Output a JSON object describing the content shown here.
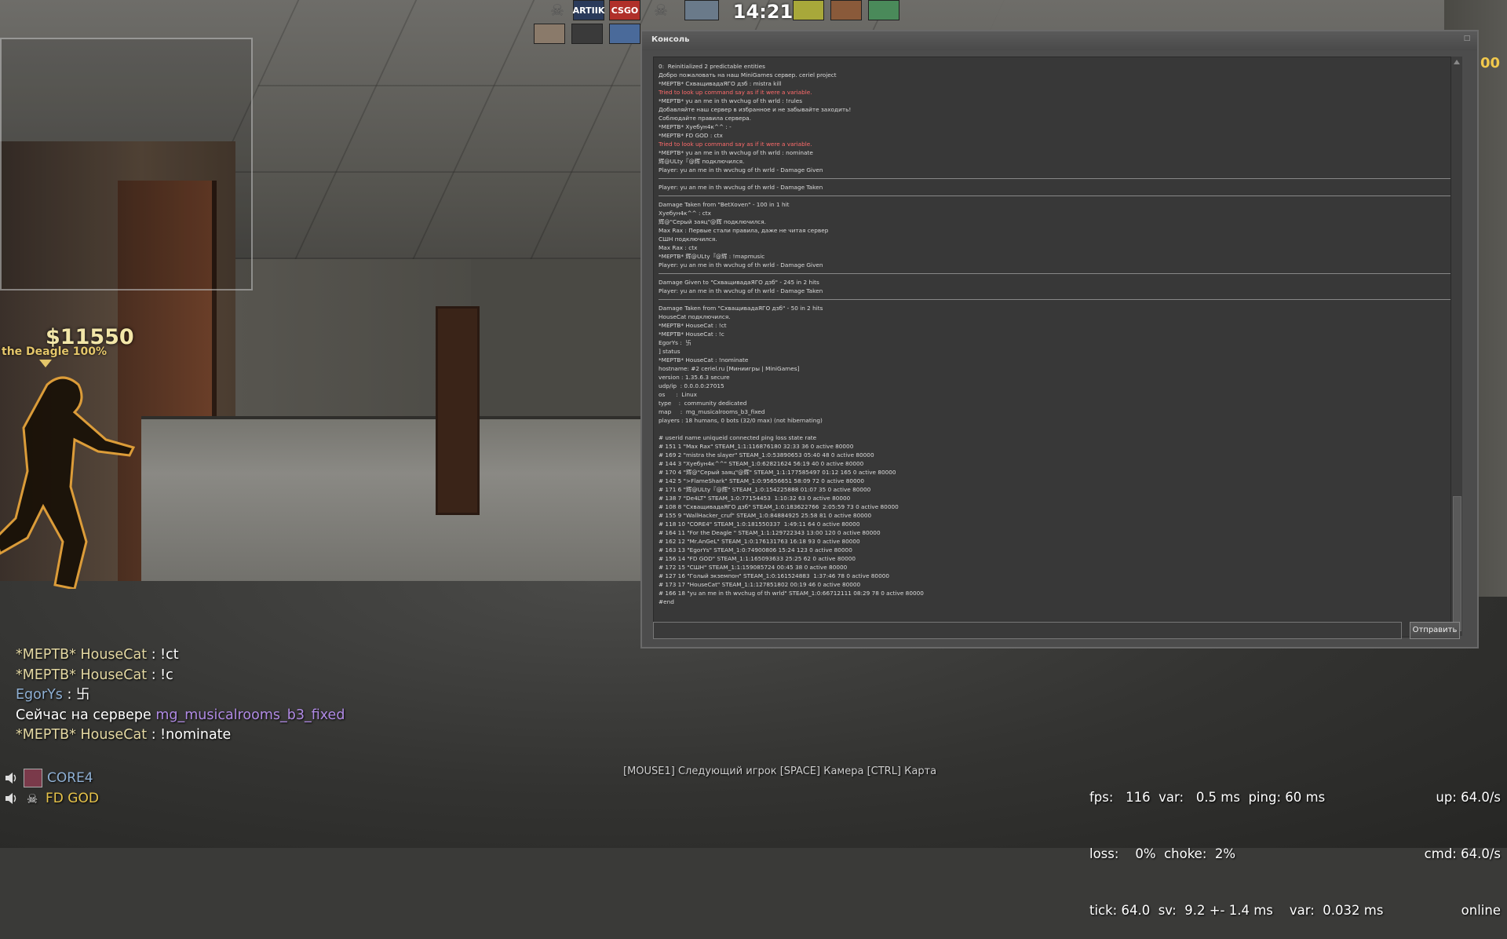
{
  "hud": {
    "money": "$11550",
    "weapon": "the Deagle  100%",
    "time": "14:21",
    "team_badges": [
      "ARTIIK",
      "CSGO"
    ],
    "score_partial": "00"
  },
  "console": {
    "title": "Консоль",
    "send_label": "Отправить",
    "input_value": "",
    "lines": [
      {
        "t": "0:  Reinitialized 2 predictable entities",
        "k": "n"
      },
      {
        "t": "Добро пожаловать на наш MiniGames сервер. ceriel project",
        "k": "n"
      },
      {
        "t": "*МЕРТВ* СхващивадаЯГО дзб : mistra kill",
        "k": "n"
      },
      {
        "t": "Tried to look up command say as if it were a variable.",
        "k": "e"
      },
      {
        "t": "*МЕРТВ* yu an me in th wvchug of th wrld : !rules",
        "k": "n"
      },
      {
        "t": "Добавляйте наш сервер в избранное и не забывайте заходить!",
        "k": "n"
      },
      {
        "t": "Соблюдайте правила сервера.",
        "k": "n"
      },
      {
        "t": "*МЕРТВ* Хуебун4к^^ : -",
        "k": "n"
      },
      {
        "t": "*МЕРТВ* FD GOD : ctx",
        "k": "n"
      },
      {
        "t": "Tried to look up command say as if it were a variable.",
        "k": "e"
      },
      {
        "t": "*МЕРТВ* yu an me in th wvchug of th wrld : nominate",
        "k": "n"
      },
      {
        "t": "辉@ULty『@辉 подключился.",
        "k": "n"
      },
      {
        "t": "Player: yu an me in th wvchug of th wrld - Damage Given",
        "k": "n"
      },
      {
        "t": "",
        "k": "s"
      },
      {
        "t": "Player: yu an me in th wvchug of th wrld - Damage Taken",
        "k": "n"
      },
      {
        "t": "",
        "k": "s"
      },
      {
        "t": "Damage Taken from \"BetXoven\" - 100 in 1 hit",
        "k": "n"
      },
      {
        "t": "Хуебун4к^^ : ctx",
        "k": "n"
      },
      {
        "t": "辉@\"Серый заяц\"@辉 подключился.",
        "k": "n"
      },
      {
        "t": "Max Rax : Первые стали правила, даже не читая сервер",
        "k": "n"
      },
      {
        "t": "СШН подключился.",
        "k": "n"
      },
      {
        "t": "Max Rax : ctx",
        "k": "n"
      },
      {
        "t": "*МЕРТВ* 辉@ULty『@辉 : !mapmusic",
        "k": "n"
      },
      {
        "t": "Player: yu an me in th wvchug of th wrld - Damage Given",
        "k": "n"
      },
      {
        "t": "",
        "k": "s"
      },
      {
        "t": "Damage Given to \"СхващивадаЯГО дзб\" - 245 in 2 hits",
        "k": "n"
      },
      {
        "t": "Player: yu an me in th wvchug of th wrld - Damage Taken",
        "k": "n"
      },
      {
        "t": "",
        "k": "s"
      },
      {
        "t": "Damage Taken from \"СхващивадаЯГО дзб\" - 50 in 2 hits",
        "k": "n"
      },
      {
        "t": "HouseCat подключился.",
        "k": "n"
      },
      {
        "t": "*МЕРТВ* HouseCat : !ct",
        "k": "n"
      },
      {
        "t": "*МЕРТВ* HouseCat : !c",
        "k": "n"
      },
      {
        "t": "EgorYs :  卐",
        "k": "n"
      },
      {
        "t": "] status",
        "k": "n"
      },
      {
        "t": "*МЕРТВ* HouseCat : !nominate",
        "k": "n"
      },
      {
        "t": "hostname: #2 ceriel.ru [Миниигры | MiniGames]",
        "k": "n"
      },
      {
        "t": "version : 1.35.6.3 secure",
        "k": "n"
      },
      {
        "t": "udp/ip  : 0.0.0.0:27015",
        "k": "n"
      },
      {
        "t": "os      :  Linux",
        "k": "n"
      },
      {
        "t": "type    :  community dedicated",
        "k": "n"
      },
      {
        "t": "map     :  mg_musicalrooms_b3_fixed",
        "k": "n"
      },
      {
        "t": "players : 18 humans, 0 bots (32/0 max) (not hibernating)",
        "k": "n"
      },
      {
        "t": "",
        "k": "n"
      },
      {
        "t": "# userid name uniqueid connected ping loss state rate",
        "k": "n"
      },
      {
        "t": "# 151 1 \"Max Rax\" STEAM_1:1:116876180 32:33 36 0 active 80000",
        "k": "n"
      },
      {
        "t": "# 169 2 \"mistra the slayer\" STEAM_1:0:53890653 05:40 48 0 active 80000",
        "k": "n"
      },
      {
        "t": "# 144 3 \"Хуебун4к^^\" STEAM_1:0:62821624 56:19 40 0 active 80000",
        "k": "n"
      },
      {
        "t": "# 170 4 \"辉@\"Серый заяц\"@辉\" STEAM_1:1:177585497 01:12 165 0 active 80000",
        "k": "n"
      },
      {
        "t": "# 142 5 \">FlameShark\" STEAM_1:0:95656651 58:09 72 0 active 80000",
        "k": "n"
      },
      {
        "t": "# 171 6 \"辉@ULty『@辉\" STEAM_1:0:154225888 01:07 35 0 active 80000",
        "k": "n"
      },
      {
        "t": "# 138 7 \"De4LT\" STEAM_1:0:77154453  1:10:32 63 0 active 80000",
        "k": "n"
      },
      {
        "t": "# 108 8 \"СхващивадаЯГО дзб\" STEAM_1:0:183622766  2:05:59 73 0 active 80000",
        "k": "n"
      },
      {
        "t": "# 155 9 \"WallHacker_cruf\" STEAM_1:0:84884925 25:58 81 0 active 80000",
        "k": "n"
      },
      {
        "t": "# 118 10 \"CORE4\" STEAM_1:0:181550337  1:49:11 64 0 active 80000",
        "k": "n"
      },
      {
        "t": "# 164 11 \"For the Deagle \" STEAM_1:1:129722343 13:00 120 0 active 80000",
        "k": "n"
      },
      {
        "t": "# 162 12 \"Mr.AnGeL\" STEAM_1:0:176131763 16:18 93 0 active 80000",
        "k": "n"
      },
      {
        "t": "# 163 13 \"EgorYs\" STEAM_1:0:74900806 15:24 123 0 active 80000",
        "k": "n"
      },
      {
        "t": "# 156 14 \"FD GOD\" STEAM_1:1:165093633 25:25 62 0 active 80000",
        "k": "n"
      },
      {
        "t": "# 172 15 \"СШН\" STEAM_1:1:159085724 00:45 38 0 active 80000",
        "k": "n"
      },
      {
        "t": "# 127 16 \"Голый экземпон\" STEAM_1:0:161524883  1:37:46 78 0 active 80000",
        "k": "n"
      },
      {
        "t": "# 173 17 \"HouseCat\" STEAM_1:1:127851802 00:19 46 0 active 80000",
        "k": "n"
      },
      {
        "t": "# 166 18 \"yu an me in th wvchug of th wrld\" STEAM_1:0:66712111 08:29 78 0 active 80000",
        "k": "n"
      },
      {
        "t": "#end",
        "k": "n"
      }
    ]
  },
  "chat": [
    {
      "name": "*МЕРТВ* HouseCat",
      "msg": " : !ct",
      "color": "gold"
    },
    {
      "name": "*МЕРТВ* HouseCat",
      "msg": " : !c",
      "color": "gold"
    },
    {
      "name": "EgorYs",
      "msg": " :  卐",
      "color": "blue"
    },
    {
      "prefix": "Сейчас на сервере ",
      "map": "mg_musicalrooms_b3_fixed"
    },
    {
      "name": "*МЕРТВ* HouseCat",
      "msg": " : !nominate",
      "color": "gold"
    }
  ],
  "voice": [
    {
      "name": "CORE4",
      "color": "blue",
      "avatar": "player-avatar-icon"
    },
    {
      "name": "FD GOD",
      "color": "gold",
      "avatar": "skull-icon"
    }
  ],
  "spectator_hint": "[MOUSE1] Следующий игрок [SPACE] Камера [CTRL] Карта",
  "netgraph": {
    "line1": "fps:   116  var:   0.5 ms  ping: 60 ms",
    "line2": "loss:    0%  choke:  2%",
    "line3": "tick: 64.0  sv:  9.2 +- 1.4 ms    var:  0.032 ms",
    "right1": "up: 64.0/s",
    "right2": "cmd: 64.0/s",
    "right3": "online"
  },
  "colors": {
    "gold_name": "#e4d8a2",
    "blue_name": "#8fb0d4",
    "map_purple": "#b08ae4",
    "error_red": "#ff6b6b",
    "money": "#f2e6a8"
  }
}
